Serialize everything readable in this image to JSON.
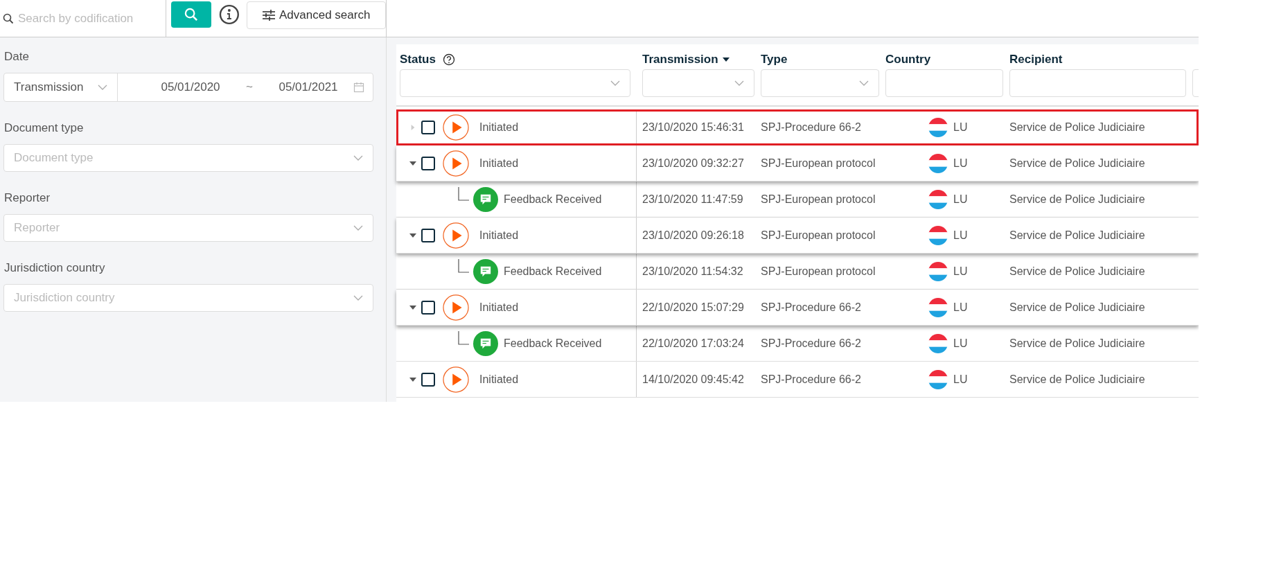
{
  "search": {
    "placeholder": "Search by codification"
  },
  "advanced_search": {
    "label": "Advanced search"
  },
  "filters": [
    {
      "label": "Date",
      "kind": "daterange",
      "select_value": "Transmission",
      "from": "05/01/2020",
      "separator": "~",
      "to": "05/01/2021"
    },
    {
      "label": "Document type",
      "kind": "select",
      "placeholder": "Document type"
    },
    {
      "label": "Reporter",
      "kind": "select",
      "placeholder": "Reporter"
    },
    {
      "label": "Jurisdiction country",
      "kind": "select",
      "placeholder": "Jurisdiction country"
    }
  ],
  "table": {
    "columns": [
      {
        "label": "Status",
        "help": true,
        "filter": {
          "kind": "select"
        }
      },
      {
        "label": "Transmission",
        "sort_descending": true,
        "filter": {
          "kind": "select"
        }
      },
      {
        "label": "Type",
        "filter": {
          "kind": "select"
        }
      },
      {
        "label": "Country",
        "filter": {
          "kind": "text"
        }
      },
      {
        "label": "Recipient",
        "filter": {
          "kind": "text"
        }
      },
      {
        "filter": {
          "kind": "text"
        }
      }
    ],
    "rows": [
      {
        "kind": "initiated",
        "status": "Initiated",
        "expanded": false,
        "highlighted": true,
        "checked": false,
        "transmission": "23/10/2020 15:46:31",
        "type": "SPJ-Procedure 66-2",
        "country": "LU",
        "recipient": "Service de Police Judiciaire"
      },
      {
        "kind": "initiated",
        "status": "Initiated",
        "expanded": true,
        "highlighted": false,
        "checked": false,
        "transmission": "23/10/2020 09:32:27",
        "type": "SPJ-European protocol",
        "country": "LU",
        "recipient": "Service de Police Judiciaire",
        "children": [
          {
            "kind": "feedback",
            "status": "Feedback Received",
            "transmission": "23/10/2020 11:47:59",
            "type": "SPJ-European protocol",
            "country": "LU",
            "recipient": "Service de Police Judiciaire"
          }
        ]
      },
      {
        "kind": "initiated",
        "status": "Initiated",
        "expanded": true,
        "highlighted": false,
        "checked": false,
        "transmission": "23/10/2020 09:26:18",
        "type": "SPJ-European protocol",
        "country": "LU",
        "recipient": "Service de Police Judiciaire",
        "children": [
          {
            "kind": "feedback",
            "status": "Feedback Received",
            "transmission": "23/10/2020 11:54:32",
            "type": "SPJ-European protocol",
            "country": "LU",
            "recipient": "Service de Police Judiciaire"
          }
        ]
      },
      {
        "kind": "initiated",
        "status": "Initiated",
        "expanded": true,
        "highlighted": false,
        "checked": false,
        "transmission": "22/10/2020 15:07:29",
        "type": "SPJ-Procedure 66-2",
        "country": "LU",
        "recipient": "Service de Police Judiciaire",
        "children": [
          {
            "kind": "feedback",
            "status": "Feedback Received",
            "transmission": "22/10/2020 17:03:24",
            "type": "SPJ-Procedure 66-2",
            "country": "LU",
            "recipient": "Service de Police Judiciaire"
          }
        ]
      },
      {
        "kind": "initiated",
        "status": "Initiated",
        "expanded": true,
        "highlighted": false,
        "checked": false,
        "transmission": "14/10/2020 09:45:42",
        "type": "SPJ-Procedure 66-2",
        "country": "LU",
        "recipient": "Service de Police Judiciaire"
      }
    ]
  }
}
